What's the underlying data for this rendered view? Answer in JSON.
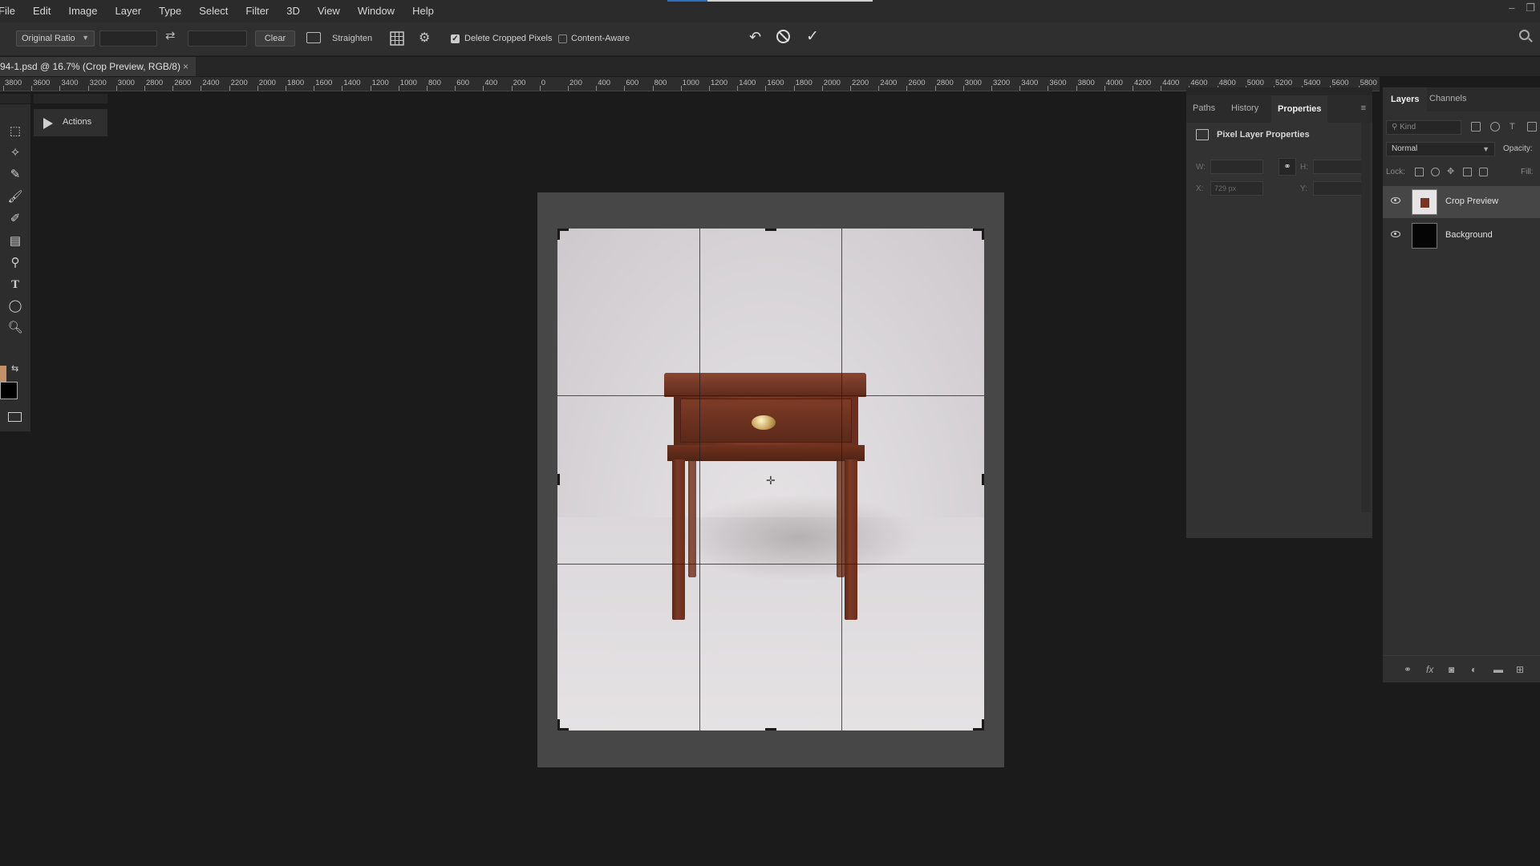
{
  "menubar": {
    "items": [
      "File",
      "Edit",
      "Image",
      "Layer",
      "Type",
      "Select",
      "Filter",
      "3D",
      "View",
      "Window",
      "Help"
    ]
  },
  "options": {
    "ratio": "Original Ratio",
    "width_value": "",
    "height_value": "",
    "clear_label": "Clear",
    "straighten_label": "Straighten",
    "delete_cropped_label": "Delete Cropped Pixels",
    "delete_cropped_checked": true,
    "content_aware_label": "Content-Aware",
    "content_aware_checked": false
  },
  "document": {
    "tab_label": "94-1.psd @ 16.7% (Crop Preview, RGB/8)",
    "close_glyph": "×"
  },
  "ruler": {
    "labels": [
      "3800",
      "3600",
      "3400",
      "3200",
      "3000",
      "2800",
      "2600",
      "2400",
      "2200",
      "2000",
      "1800",
      "1600",
      "1400",
      "1200",
      "1000",
      "800",
      "600",
      "400",
      "200",
      "0",
      "200",
      "400",
      "600",
      "800",
      "1000",
      "1200",
      "1400",
      "1600",
      "1800",
      "2000",
      "2200",
      "2400",
      "2600",
      "2800",
      "3000",
      "3200",
      "3400",
      "3600",
      "3800",
      "4000",
      "4200",
      "4400",
      "4600",
      "4800",
      "5000",
      "5200",
      "5400",
      "5600",
      "5800"
    ]
  },
  "actions_panel": {
    "label": "Actions"
  },
  "properties_panel": {
    "tabs": [
      "Paths",
      "History",
      "Properties"
    ],
    "active_tab": "Properties",
    "header": "Pixel Layer Properties",
    "w_label": "W:",
    "h_label": "H:",
    "x_label": "X:",
    "y_label": "Y:",
    "x_value": "729 px",
    "link_glyph": "⚭"
  },
  "layers_panel": {
    "tabs": [
      "Layers",
      "Channels"
    ],
    "active_tab": "Layers",
    "kind_placeholder": "Kind",
    "blend_mode": "Normal",
    "opacity_label": "Opacity:",
    "lock_label": "Lock:",
    "fill_label": "Fill:",
    "layers": [
      {
        "name": "Crop Preview",
        "visible": true,
        "selected": true
      },
      {
        "name": "Background",
        "visible": true,
        "selected": false
      }
    ],
    "footer_icons": [
      "link-icon",
      "fx-icon",
      "mask-icon",
      "adjustment-icon",
      "group-icon",
      "new-layer-icon"
    ]
  },
  "colors": {
    "foreground": "#c49068",
    "background": "#000000",
    "accent": "#2d6fbf"
  }
}
